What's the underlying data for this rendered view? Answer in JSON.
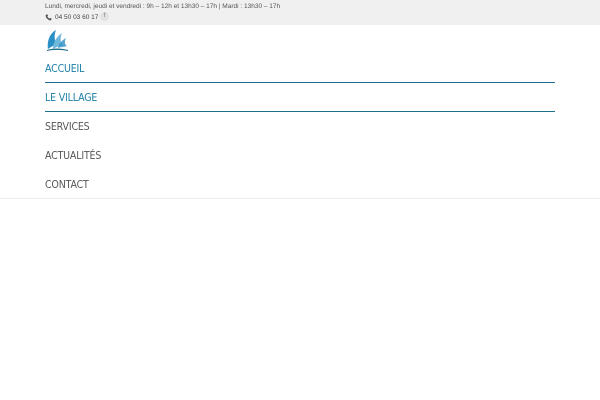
{
  "topbar": {
    "hours_text": "Lundi, mercredi, jeudi et vendredi : 9h – 12h et 13h30 – 17h | Mardi : 13h30 – 17h",
    "phone": "04 50 03 60 17",
    "facebook_glyph": "f",
    "icons": [
      "phone-icon",
      "facebook-icon"
    ]
  },
  "logo": {
    "icon": "village-logo",
    "colors": {
      "primary": "#2a8fc4",
      "secondary": "#6fb8dc"
    }
  },
  "nav": {
    "items": [
      {
        "label": "ACCUEIL",
        "active": true
      },
      {
        "label": "LE VILLAGE",
        "active": true
      },
      {
        "label": "SERVICES",
        "active": false
      },
      {
        "label": "ACTUALITÉS",
        "active": false
      },
      {
        "label": "CONTACT",
        "active": false
      }
    ]
  },
  "colors": {
    "accent": "#1a7fa6",
    "underline": "#1c6e8c",
    "topbar_bg": "#f0f0f0",
    "text": "#555555"
  }
}
